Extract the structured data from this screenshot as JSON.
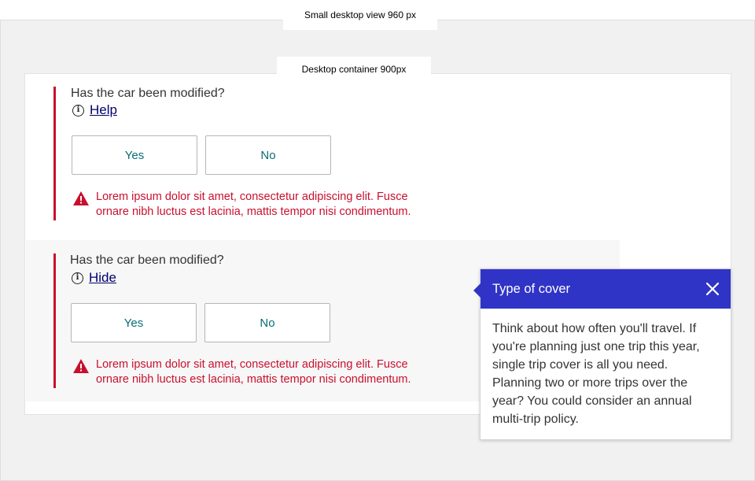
{
  "labels": {
    "view": "Small desktop view 960 px",
    "container": "Desktop container 900px"
  },
  "questions": [
    {
      "title": "Has the car been modified?",
      "help_link": "Help",
      "options": [
        "Yes",
        "No"
      ],
      "error": "Lorem ipsum dolor sit amet, consectetur adipiscing elit. Fusce ornare nibh luctus est lacinia, mattis tempor nisi condimentum."
    },
    {
      "title": "Has the car been modified?",
      "help_link": "Hide",
      "options": [
        "Yes",
        "No"
      ],
      "error": "Lorem ipsum dolor sit amet, consectetur adipiscing elit. Fusce ornare nibh luctus est lacinia, mattis tempor nisi condimentum."
    }
  ],
  "popover": {
    "title": "Type of cover",
    "body": "Think about how often you'll travel. If you're planning just one trip this year, single trip cover is all you need. Planning two or more trips over the year? You could consider an annual multi-trip policy."
  },
  "icons": {
    "help": "info-icon",
    "error": "warning-icon",
    "close": "close-icon"
  },
  "colors": {
    "error": "#c8102e",
    "popover_header": "#2f34c6",
    "option_text": "#0a6d73",
    "link": "#00006e"
  }
}
